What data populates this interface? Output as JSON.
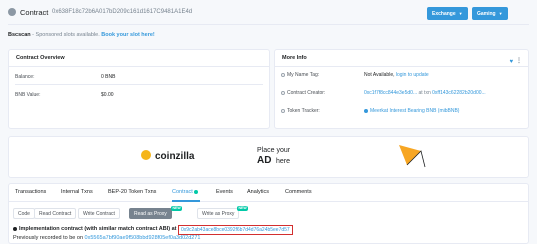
{
  "header": {
    "title": "Contract",
    "address": "0x638F18c72b6A017bD209c161d1617C9481A1E4d",
    "exchange_label": "Exchange",
    "gaming_label": "Gaming"
  },
  "sponsored": {
    "brand": "Bscscan",
    "text": "- Sponsored slots available.",
    "link": "Book your slot here!"
  },
  "overview": {
    "title": "Contract Overview",
    "rows": [
      {
        "label": "Balance:",
        "value": "0 BNB"
      },
      {
        "label": "BNB Value:",
        "value": "$0.00"
      }
    ]
  },
  "more_info": {
    "title": "More Info",
    "name_tag": {
      "label": "My Name Tag:",
      "value": "Not Available,",
      "link": "login to update"
    },
    "creator": {
      "label": "Contract Creator:",
      "address": "0xc1f7f8cc844e3e5d0...",
      "at_txn": "at txn",
      "txn": "0xff143c62282b20d00..."
    },
    "token_tracker": {
      "label": "Token Tracker:",
      "value": "Meerkat Interest Bearing BNB (mibBNB)"
    }
  },
  "ad": {
    "brand": "coinzilla",
    "line1": "Place your",
    "line2": "AD",
    "line3": "here"
  },
  "tabs": [
    {
      "label": "Transactions"
    },
    {
      "label": "Internal Txns"
    },
    {
      "label": "BEP-20 Token Txns"
    },
    {
      "label": "Contract"
    },
    {
      "label": "Events"
    },
    {
      "label": "Analytics"
    },
    {
      "label": "Comments"
    }
  ],
  "subtabs": [
    {
      "label": "Code"
    },
    {
      "label": "Read Contract"
    },
    {
      "label": "Write Contract"
    },
    {
      "label": "Read as Proxy"
    },
    {
      "label": "Write as Proxy"
    }
  ],
  "new_badge": "NEW",
  "implementation": {
    "text": "Implementation contract (with similar match contract ABI) at",
    "address": "0x9c2ab43ace8bce0392f6b7d4d76a24b5ee7d57"
  },
  "previous": {
    "text": "Previously recorded to be on",
    "address": "0x5565a7bf90ae9f508bbd928f05ef0a3d02d271"
  }
}
